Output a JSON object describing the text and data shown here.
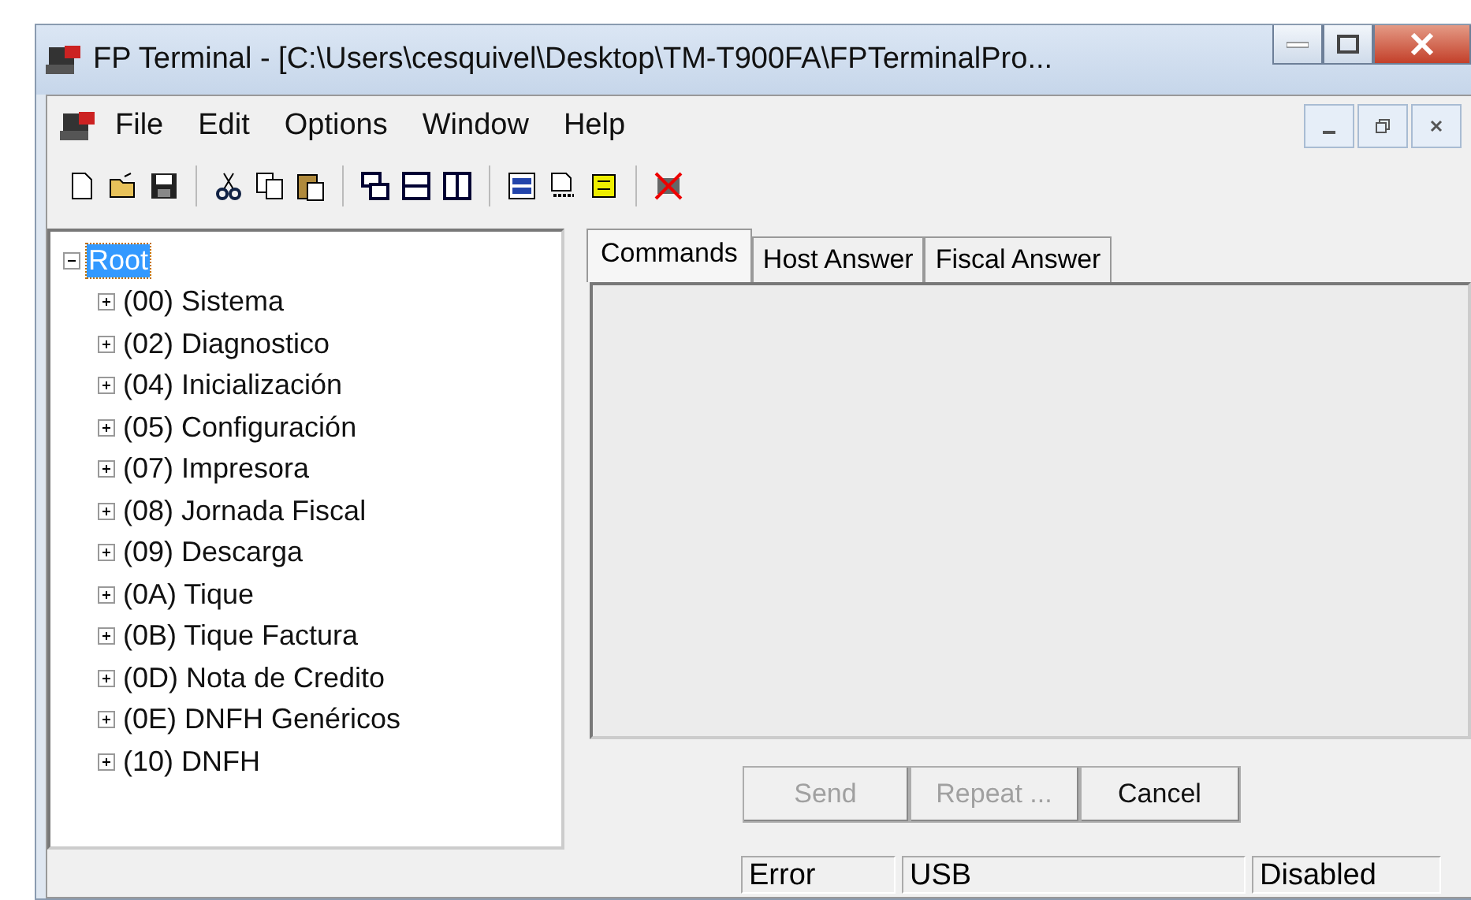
{
  "window": {
    "title": "FP Terminal - [C:\\Users\\cesquivel\\Desktop\\TM-T900FA\\FPTerminalPro..."
  },
  "menu": [
    "File",
    "Edit",
    "Options",
    "Window",
    "Help"
  ],
  "tree": {
    "label": "Root",
    "selected": true,
    "expanded": true,
    "children": [
      {
        "label": "(00) Sistema",
        "expanded": false
      },
      {
        "label": "(02) Diagnostico",
        "expanded": false
      },
      {
        "label": "(04) Inicialización",
        "expanded": false
      },
      {
        "label": "(05) Configuración",
        "expanded": false
      },
      {
        "label": "(07) Impresora",
        "expanded": false
      },
      {
        "label": "(08) Jornada Fiscal",
        "expanded": false
      },
      {
        "label": "(09) Descarga",
        "expanded": false
      },
      {
        "label": "(0A) Tique",
        "expanded": false
      },
      {
        "label": "(0B) Tique Factura",
        "expanded": false
      },
      {
        "label": "(0D) Nota de Credito",
        "expanded": false
      },
      {
        "label": "(0E) DNFH Genéricos",
        "expanded": false
      },
      {
        "label": "(10) DNFH",
        "expanded": false
      }
    ]
  },
  "tabs": [
    {
      "label": "Commands",
      "selected": true
    },
    {
      "label": "Host Answer",
      "selected": false
    },
    {
      "label": "Fiscal Answer",
      "selected": false
    }
  ],
  "buttons": [
    {
      "label": "Send",
      "disabled": true
    },
    {
      "label": "Repeat ...",
      "disabled": true
    },
    {
      "label": "Cancel",
      "disabled": false
    }
  ],
  "status_bar": [
    "Error",
    "USB",
    "Disabled"
  ]
}
